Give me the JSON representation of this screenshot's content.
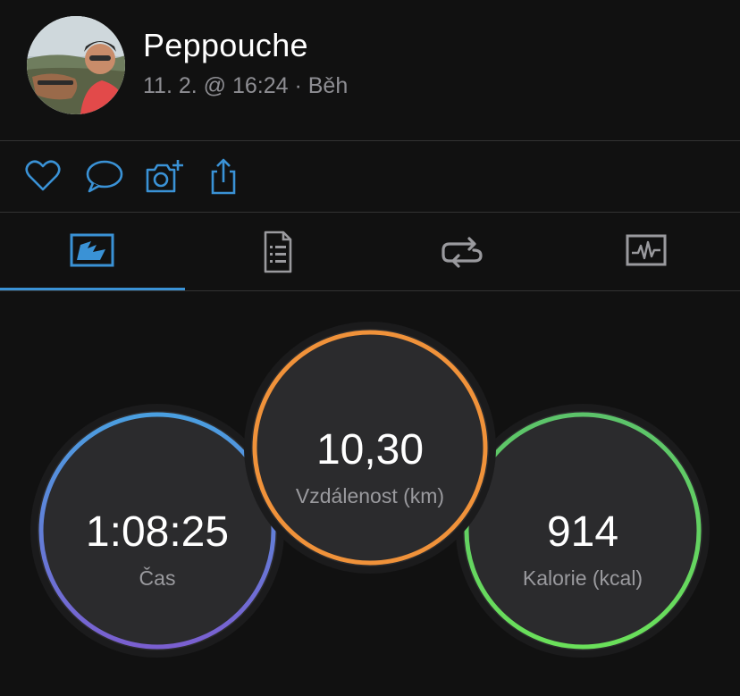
{
  "header": {
    "user_name": "Peppouche",
    "activity_meta": "11. 2. @ 16:24 · Běh"
  },
  "actions": [
    {
      "name": "like-button",
      "icon": "heart-icon"
    },
    {
      "name": "comment-button",
      "icon": "speech-bubble-icon"
    },
    {
      "name": "add-photo-button",
      "icon": "camera-plus-icon"
    },
    {
      "name": "share-button",
      "icon": "share-icon"
    }
  ],
  "tabs": [
    {
      "name": "tab-overview",
      "icon": "overview-icon",
      "active": true
    },
    {
      "name": "tab-details",
      "icon": "document-list-icon",
      "active": false
    },
    {
      "name": "tab-laps",
      "icon": "repeat-icon",
      "active": false
    },
    {
      "name": "tab-charts",
      "icon": "heart-rate-chart-icon",
      "active": false
    }
  ],
  "stats": {
    "time": {
      "value": "1:08:25",
      "label": "Čas",
      "ring_colors": [
        "#4a9fe0",
        "#7a5fd0"
      ]
    },
    "distance": {
      "value": "10,30",
      "label": "Vzdálenost (km)",
      "ring_colors": [
        "#f0923a",
        "#f0923a"
      ]
    },
    "calories": {
      "value": "914",
      "label": "Kalorie (kcal)",
      "ring_colors": [
        "#5cc36a",
        "#6ae05a"
      ]
    }
  },
  "colors": {
    "accent": "#3a92d6",
    "background": "#111111"
  }
}
